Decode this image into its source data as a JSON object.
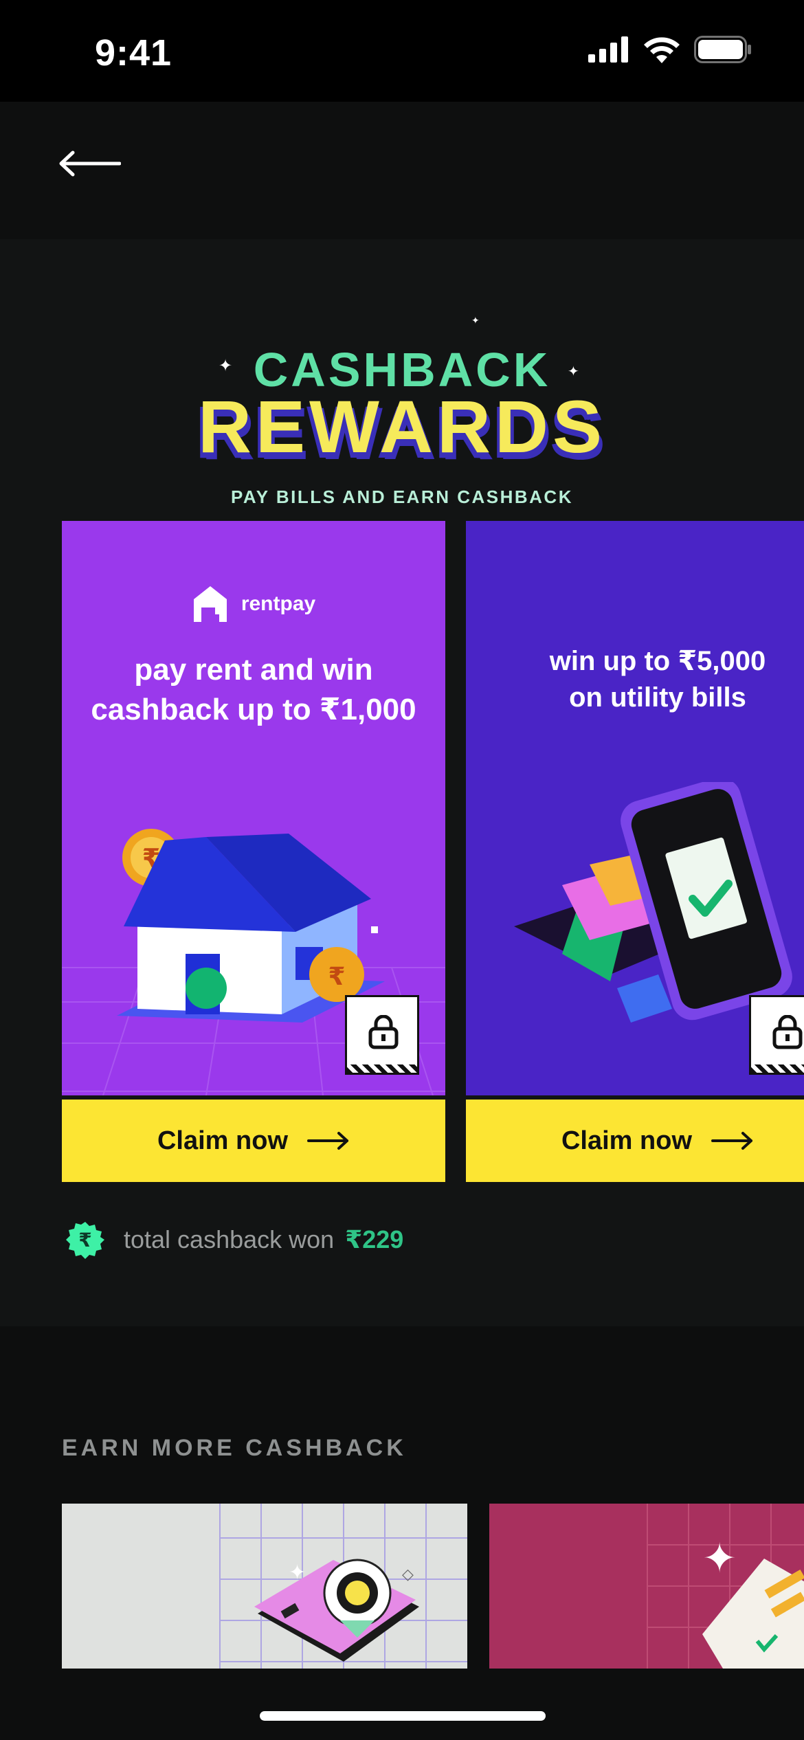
{
  "status_bar": {
    "time": "9:41"
  },
  "header": {
    "back_icon": "arrow-left-icon"
  },
  "hero": {
    "title_line1": "CASHBACK",
    "title_line2": "REWARDS",
    "subtitle": "PAY BILLS AND EARN CASHBACK"
  },
  "cards": [
    {
      "brand": "rentpay",
      "headline_line1": "pay rent and win",
      "headline_line2": "cashback up to ₹1,000",
      "cta": "Claim now",
      "color": "#9a39ec"
    },
    {
      "headline_line1": "win up to ₹5,000",
      "headline_line2": "on utility bills",
      "cta": "Claim now",
      "color": "#4a24c6"
    }
  ],
  "total": {
    "label": "total cashback won",
    "value": "₹229",
    "icon": "rupee-badge-icon"
  },
  "earn_more": {
    "title": "EARN MORE CASHBACK"
  },
  "colors": {
    "accent_yellow": "#fce533",
    "accent_green": "#2fc487"
  }
}
